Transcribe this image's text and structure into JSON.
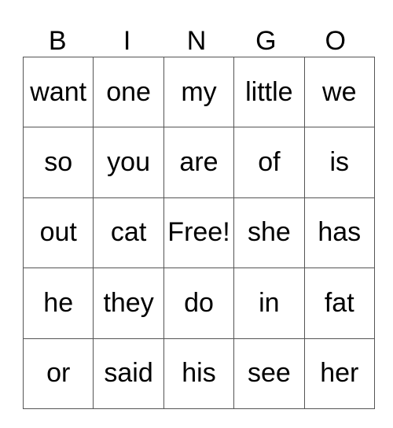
{
  "header": [
    "B",
    "I",
    "N",
    "G",
    "O"
  ],
  "rows": [
    [
      "want",
      "one",
      "my",
      "little",
      "we"
    ],
    [
      "so",
      "you",
      "are",
      "of",
      "is"
    ],
    [
      "out",
      "cat",
      "Free!",
      "she",
      "has"
    ],
    [
      "he",
      "they",
      "do",
      "in",
      "fat"
    ],
    [
      "or",
      "said",
      "his",
      "see",
      "her"
    ]
  ]
}
